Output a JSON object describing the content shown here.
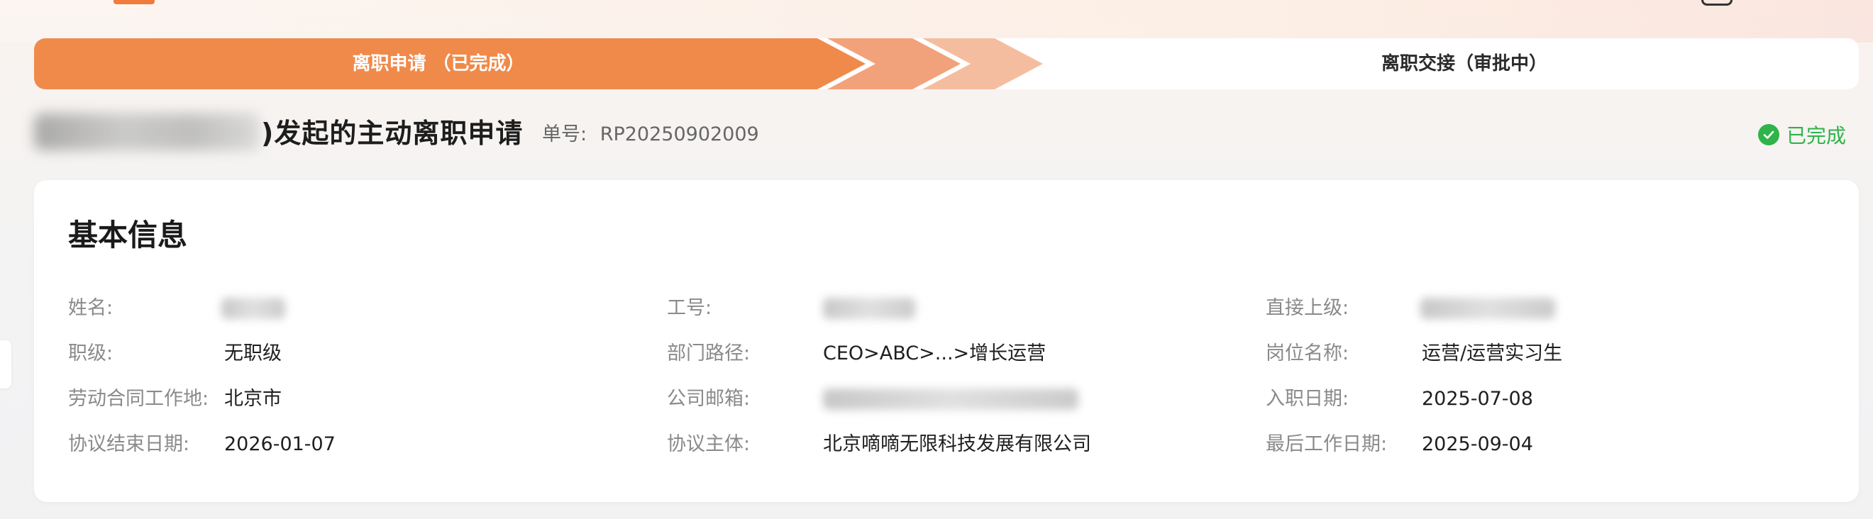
{
  "progress": {
    "step1": "离职申请 （已完成）",
    "step2": "离职交接（审批中）"
  },
  "header": {
    "title": ")发起的主动离职申请",
    "order_label": "单号:",
    "order_no": "RP20250902009",
    "status": "已完成"
  },
  "card": {
    "title": "基本信息",
    "rows": [
      [
        {
          "label": "姓名:",
          "value": ""
        },
        {
          "label": "工号:",
          "value": ""
        },
        {
          "label": "直接上级:",
          "value": ""
        }
      ],
      [
        {
          "label": "职级:",
          "value": "无职级"
        },
        {
          "label": "部门路径:",
          "value": "CEO>ABC>...>增长运营"
        },
        {
          "label": "岗位名称:",
          "value": "运营/运营实习生"
        }
      ],
      [
        {
          "label": "劳动合同工作地:",
          "value": "北京市"
        },
        {
          "label": "公司邮箱:",
          "value": ""
        },
        {
          "label": "入职日期:",
          "value": "2025-07-08"
        }
      ],
      [
        {
          "label": "协议结束日期:",
          "value": "2026-01-07"
        },
        {
          "label": "协议主体:",
          "value": "北京嘀嘀无限科技发展有限公司"
        },
        {
          "label": "最后工作日期:",
          "value": "2025-09-04"
        }
      ]
    ]
  },
  "colors": {
    "accent": "#f07c3c",
    "success": "#2fb34a"
  }
}
